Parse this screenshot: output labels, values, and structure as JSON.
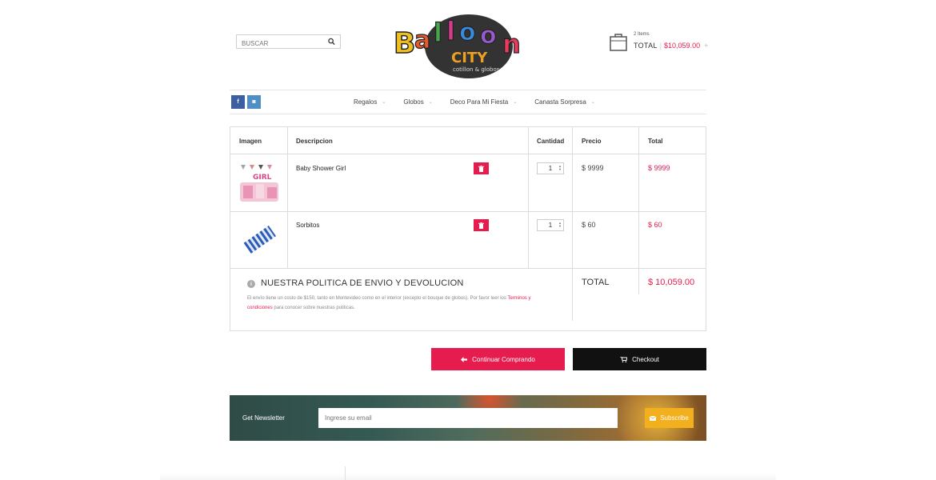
{
  "header": {
    "search": {
      "placeholder": "BUSCAR"
    },
    "cart": {
      "items": "2 Items",
      "total_label": "TOTAL",
      "total_value": "$10,059.00",
      "plus": "+"
    }
  },
  "nav": {
    "social": [
      {
        "label": "f"
      },
      {
        "label": "◙"
      }
    ],
    "menu": [
      {
        "label": "Regalos"
      },
      {
        "label": "Globos"
      },
      {
        "label": "Deco Para Mi Fiesta"
      },
      {
        "label": "Canasta Sorpresa"
      }
    ]
  },
  "table": {
    "headers": {
      "image": "Imagen",
      "description": "Descripcion",
      "quantity": "Cantidad",
      "price": "Precio",
      "total": "Total"
    },
    "rows": [
      {
        "name": "Baby Shower Girl",
        "qty": "1",
        "price": "$ 9999",
        "total": "$ 9999"
      },
      {
        "name": "Sorbitos",
        "qty": "1",
        "price": "$ 60",
        "total": "$ 60"
      }
    ],
    "policy": {
      "title": "NUESTRA POLITICA DE ENVIO Y DEVOLUCION",
      "text_before": "El envío tiene un costo de $150, tanto en Montevideo como en el interior (excepto el bouque de globos). Por favor leer los ",
      "link": "Terminos y condiciones",
      "text_after": " para conocer sobre nuestras politicas."
    },
    "summary": {
      "label": "TOTAL",
      "value": "$ 10,059.00"
    }
  },
  "actions": {
    "continue": "Continuar Comprando",
    "checkout": "Checkout"
  },
  "newsletter": {
    "label": "Get Newsletter",
    "placeholder": "Ingrese su email",
    "button": "Subscribe"
  },
  "colors": {
    "accent": "#e51c4d",
    "dark": "#111111",
    "subscribe": "#f2b01e"
  }
}
